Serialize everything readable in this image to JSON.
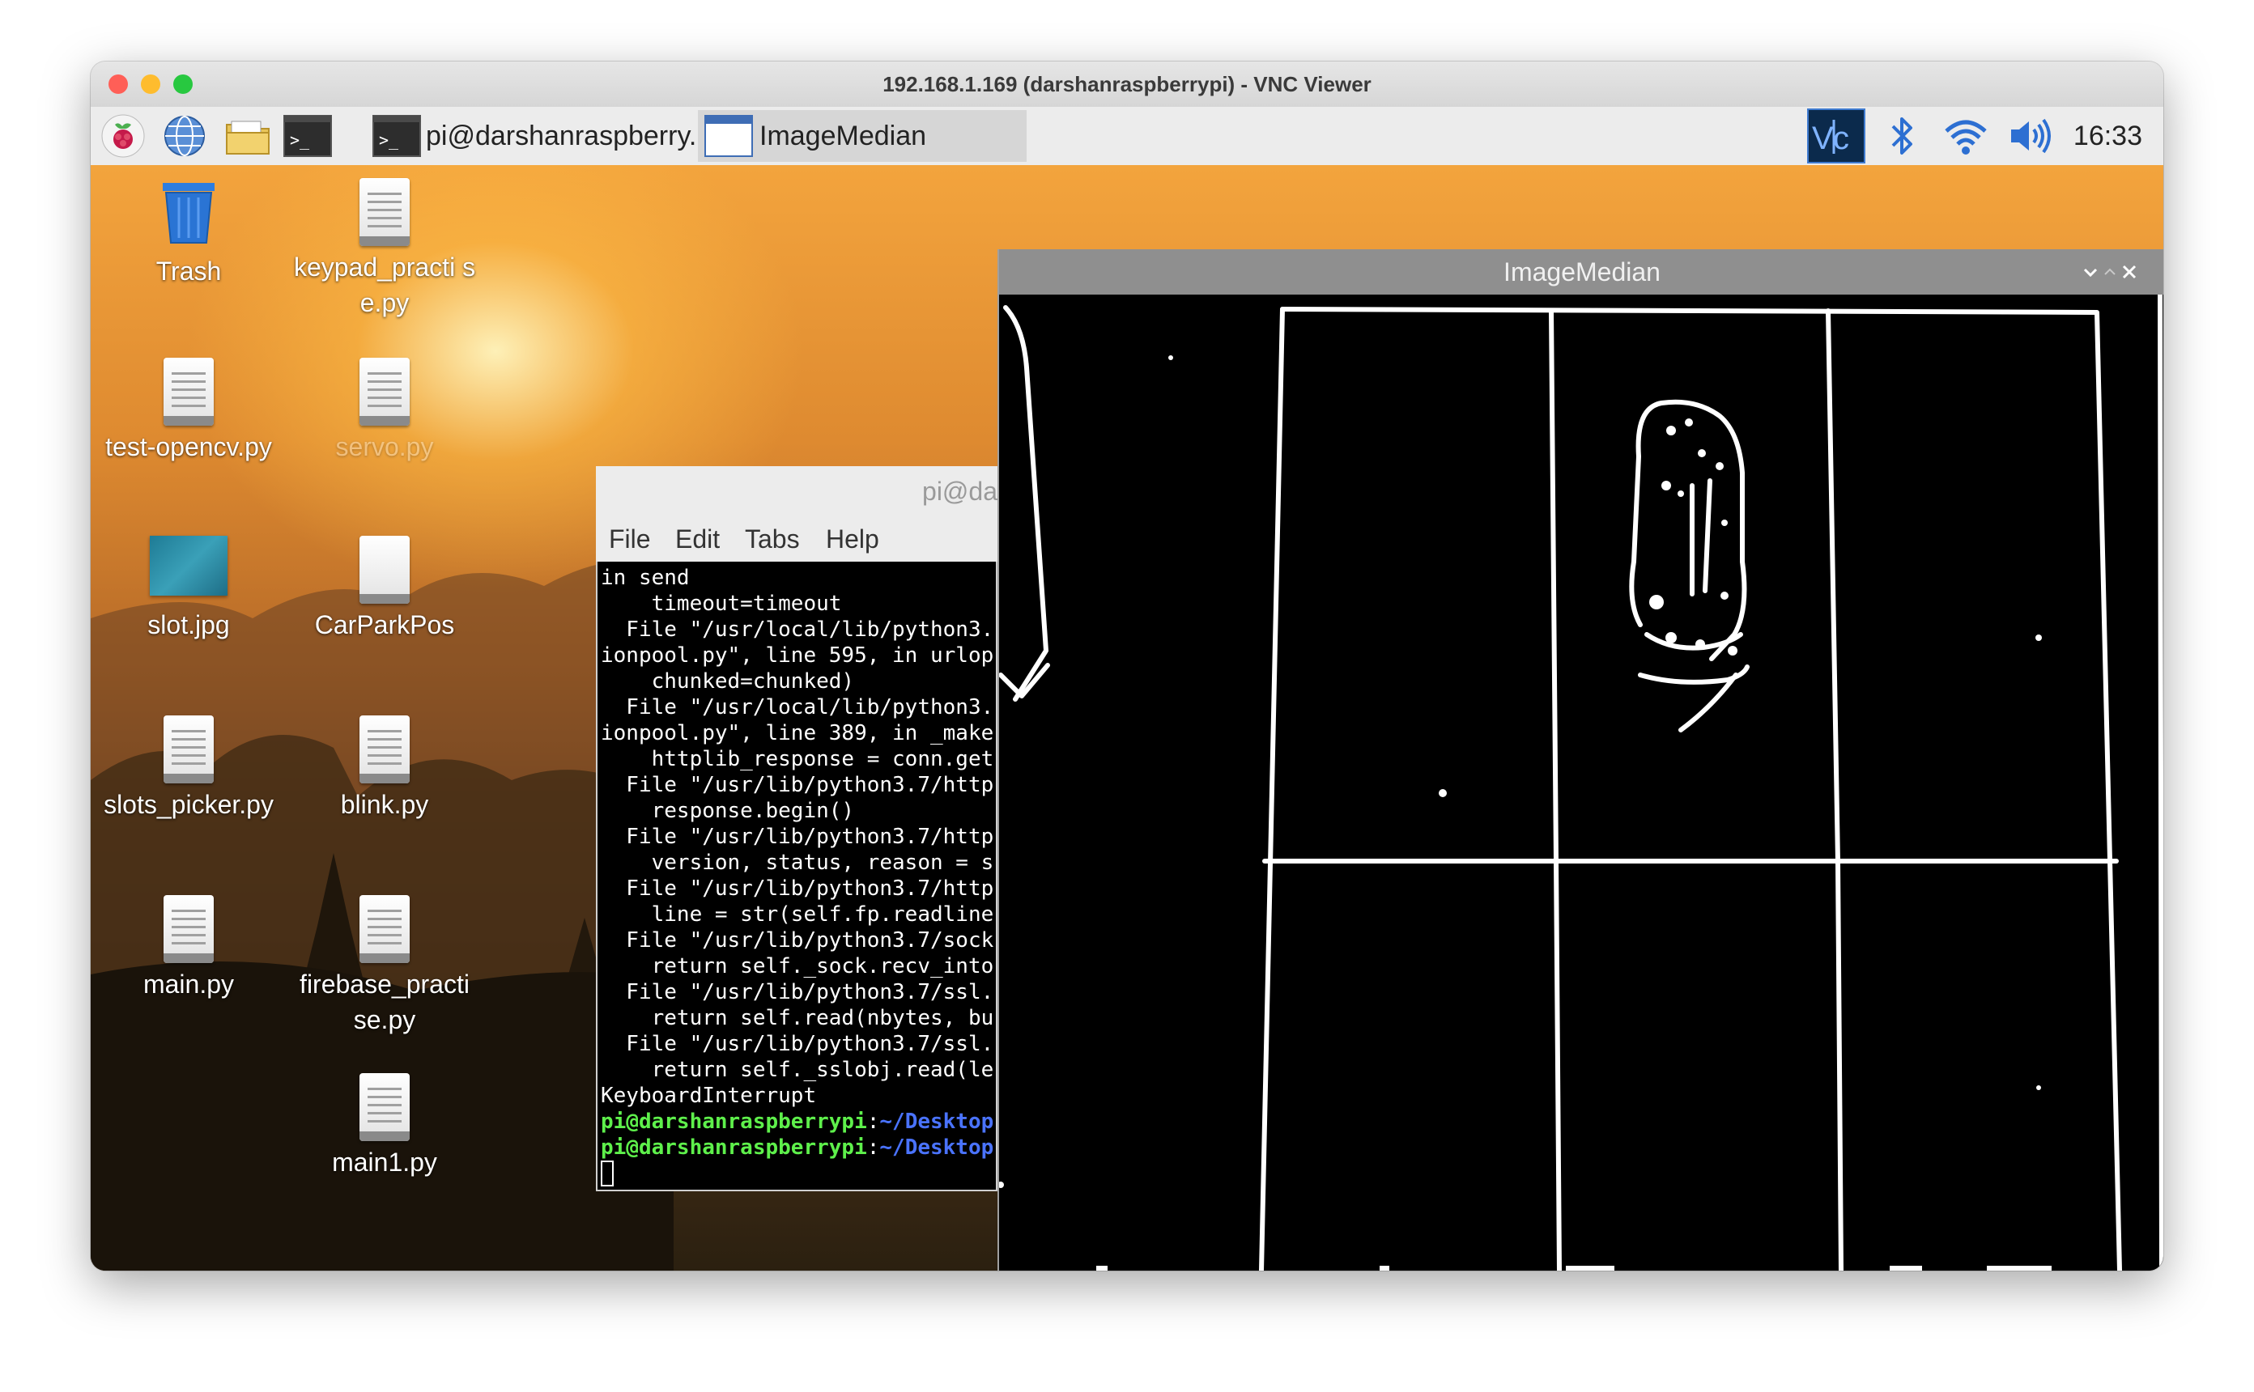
{
  "window": {
    "title": "192.168.1.169 (darshanraspberrypi) - VNC Viewer",
    "traffic_colors": {
      "close": "#ff5f57",
      "minimize": "#febc2e",
      "maximize": "#28c840"
    }
  },
  "taskbar": {
    "launchers": [
      "raspberry-menu-icon",
      "web-browser-icon",
      "file-manager-icon",
      "terminal-icon"
    ],
    "tasks": [
      {
        "label": "pi@darshanraspberry...",
        "icon": "terminal-icon",
        "active": false
      },
      {
        "label": "ImageMedian",
        "icon": "window-icon",
        "active": true
      }
    ],
    "tray": [
      "vnc-server-icon",
      "bluetooth-icon",
      "wifi-icon",
      "volume-icon"
    ],
    "clock": "16:33"
  },
  "desktop": {
    "icons": [
      {
        "name": "Trash",
        "type": "trash"
      },
      {
        "name": "keypad_practi se.py",
        "type": "file"
      },
      {
        "name": "test-opencv.py",
        "type": "file"
      },
      {
        "name": "servo.py",
        "type": "file"
      },
      {
        "name": "slot.jpg",
        "type": "image"
      },
      {
        "name": "CarParkPos",
        "type": "blank"
      },
      {
        "name": "slots_picker.py",
        "type": "file"
      },
      {
        "name": "blink.py",
        "type": "file"
      },
      {
        "name": "main.py",
        "type": "file"
      },
      {
        "name": "firebase_practi se.py",
        "type": "file"
      },
      {
        "name": "main1.py",
        "type": "file"
      }
    ]
  },
  "terminal": {
    "title": "pi@da",
    "menu": [
      "File",
      "Edit",
      "Tabs",
      "Help"
    ],
    "lines": [
      "in send",
      "    timeout=timeout",
      "  File \"/usr/local/lib/python3.",
      "ionpool.py\", line 595, in urlop",
      "    chunked=chunked)",
      "  File \"/usr/local/lib/python3.",
      "ionpool.py\", line 389, in _make",
      "    httplib_response = conn.get",
      "  File \"/usr/lib/python3.7/http",
      "    response.begin()",
      "  File \"/usr/lib/python3.7/http",
      "    version, status, reason = s",
      "  File \"/usr/lib/python3.7/http",
      "    line = str(self.fp.readline",
      "  File \"/usr/lib/python3.7/sock",
      "    return self._sock.recv_into",
      "  File \"/usr/lib/python3.7/ssl.",
      "    return self.read(nbytes, bu",
      "  File \"/usr/lib/python3.7/ssl.",
      "    return self._sslobj.read(le",
      "KeyboardInterrupt"
    ],
    "prompts": [
      {
        "user": "pi@darshanraspberrypi",
        "sep": ":",
        "path": "~/Desktop"
      },
      {
        "user": "pi@darshanraspberrypi",
        "sep": ":",
        "path": "~/Desktop"
      }
    ]
  },
  "imagemedian": {
    "title": "ImageMedian",
    "controls": [
      "chevron-down-icon",
      "chevron-up-icon",
      "close-icon"
    ]
  }
}
